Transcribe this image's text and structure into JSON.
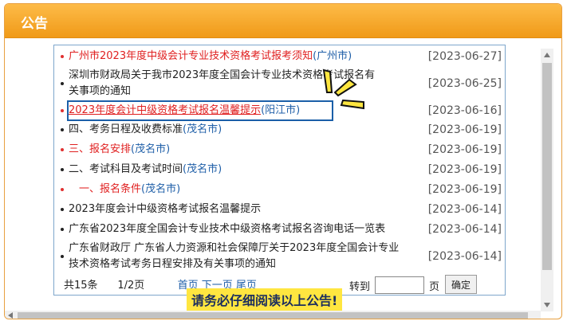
{
  "panel": {
    "title": "公告"
  },
  "announcements": [
    {
      "title": "广州市2023年度中级会计专业技术资格考试报考须知",
      "location": "(广州市)",
      "date": "[2023-06-27]",
      "red": true
    },
    {
      "title": "深圳市财政局关于我市2023年度全国会计专业技术资格考试报名有",
      "title2": "关事项的通知",
      "location": "",
      "date": "[2023-06-25]",
      "red": false
    },
    {
      "title": "2023年度会计中级资格考试报名温馨提示",
      "location": "(阳江市)",
      "date": "[2023-06-16]",
      "red": true
    },
    {
      "title": "四、考务日程及收费标准",
      "location": "(茂名市)",
      "date": "[2023-06-19]",
      "red": false
    },
    {
      "title": "三、报名安排",
      "location": "(茂名市)",
      "date": "[2023-06-19]",
      "red": true
    },
    {
      "title": "二、考试科目及考试时间",
      "location": "(茂名市)",
      "date": "[2023-06-19]",
      "red": false
    },
    {
      "title": "　一、报名条件",
      "location": "(茂名市)",
      "date": "[2023-06-19]",
      "red": true
    },
    {
      "title": "2023年度会计中级资格考试报名温馨提示",
      "location": "",
      "date": "[2023-06-14]",
      "red": false
    },
    {
      "title": "广东省2023年度全国会计专业技术中级资格考试报名咨询电话一览表",
      "location": "",
      "date": "[2023-06-14]",
      "red": false
    },
    {
      "title": "广东省财政厅 广东省人力资源和社会保障厅关于2023年度全国会计专业",
      "title2": "技术资格考试考务日程安排及有关事项的通知",
      "location": "",
      "date": "[2023-06-14]",
      "red": false
    }
  ],
  "pager": {
    "total": "共15条",
    "page": "1/2页",
    "first": "首页",
    "next": "下一页",
    "last": "尾页",
    "goto_label": "转到",
    "goto_unit": "页",
    "confirm": "确定"
  },
  "notice": "请务必仔细阅读以上公告!",
  "colors": {
    "header": "#f5a623",
    "red": "#e02020",
    "link": "#1f5fa8",
    "notice_bg": "#ffe640"
  }
}
